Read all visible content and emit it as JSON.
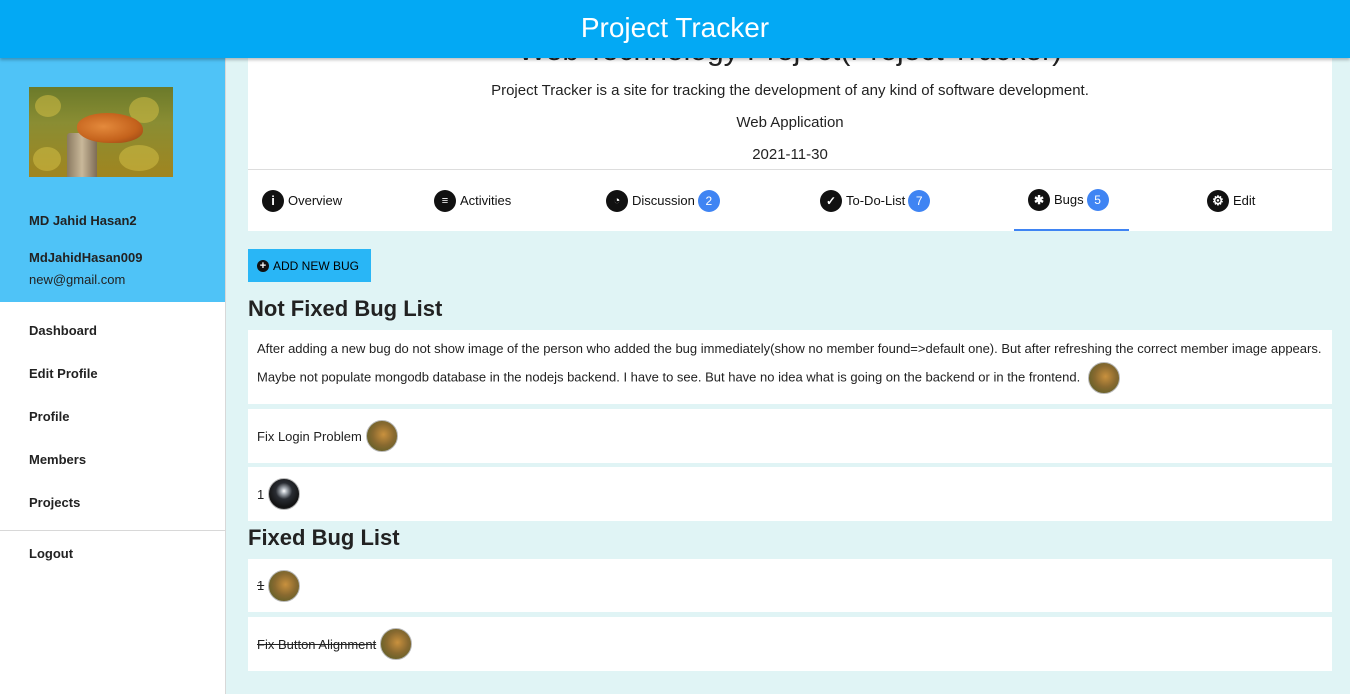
{
  "app": {
    "title": "Project Tracker"
  },
  "user": {
    "name": "MD Jahid Hasan2",
    "username": "MdJahidHasan009",
    "email": "new@gmail.com"
  },
  "nav": {
    "items": [
      "Dashboard",
      "Edit Profile",
      "Profile",
      "Members",
      "Projects"
    ],
    "logout": "Logout"
  },
  "project": {
    "title": "Web Technology Project(Project Tracker)",
    "description": "Project Tracker is a site for tracking the development of any kind of software development.",
    "type": "Web Application",
    "date": "2021-11-30"
  },
  "tabs": [
    {
      "label": "Overview",
      "icon": "info-icon"
    },
    {
      "label": "Activities",
      "icon": "clipboard-icon"
    },
    {
      "label": "Discussion",
      "icon": "comments-icon",
      "badge": "2"
    },
    {
      "label": "To-Do-List",
      "icon": "check-circle-icon",
      "badge": "7"
    },
    {
      "label": "Bugs",
      "icon": "bug-icon",
      "badge": "5",
      "active": true
    },
    {
      "label": "Edit",
      "icon": "gear-icon"
    }
  ],
  "bugs": {
    "add_label": "ADD NEW BUG",
    "not_fixed_title": "Not Fixed Bug List",
    "not_fixed": [
      "After adding a new bug do not show image of the person who added the bug immediately(show no member found=>default one). But after refreshing the correct member image appears. Maybe not populate mongodb database in the nodejs backend. I have to see. But have no idea what is going on the backend or in the frontend.",
      "Fix Login Problem",
      "1"
    ],
    "fixed_title": "Fixed Bug List",
    "fixed": [
      "1",
      "Fix Button Alignment"
    ]
  },
  "colors": {
    "header": "#03a9f4",
    "profile_panel": "#4fc3f7",
    "badge": "#3f84f3",
    "page_bg": "#e0f4f5"
  }
}
